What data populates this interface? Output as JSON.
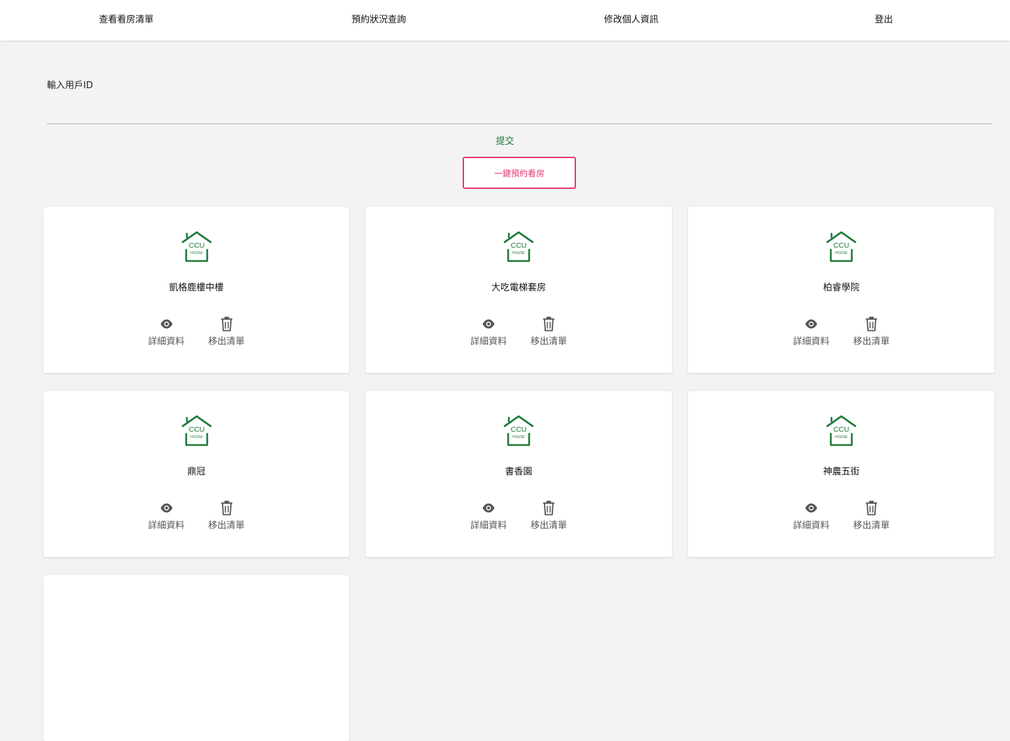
{
  "nav": {
    "items": [
      {
        "label": "查看看房清單"
      },
      {
        "label": "預約狀況查詢"
      },
      {
        "label": "修改個人資訊"
      },
      {
        "label": "登出"
      }
    ]
  },
  "form": {
    "user_id_label": "輸入用戶ID",
    "user_id_value": "",
    "submit_label": "提交",
    "booking_button_label": "一鍵預約看房"
  },
  "colors": {
    "accent_green": "#1e7a3a",
    "accent_pink": "#e63978"
  },
  "logo": {
    "text_top": "CCU",
    "text_bottom": "HOUSE"
  },
  "cards": [
    {
      "name": "凱格鹿樓中樓",
      "details_label": "詳細資料",
      "remove_label": "移出清單"
    },
    {
      "name": "大吃電梯套房",
      "details_label": "詳細資料",
      "remove_label": "移出清單"
    },
    {
      "name": "柏睿學院",
      "details_label": "詳細資料",
      "remove_label": "移出清單"
    },
    {
      "name": "鼎冠",
      "details_label": "詳細資料",
      "remove_label": "移出清單"
    },
    {
      "name": "書香園",
      "details_label": "詳細資料",
      "remove_label": "移出清單"
    },
    {
      "name": "神農五街",
      "details_label": "詳細資料",
      "remove_label": "移出清單"
    },
    {
      "name": "",
      "details_label": "",
      "remove_label": ""
    }
  ],
  "icons": {
    "details": "eye-icon",
    "remove": "trash-icon",
    "logo": "house-logo-icon"
  }
}
